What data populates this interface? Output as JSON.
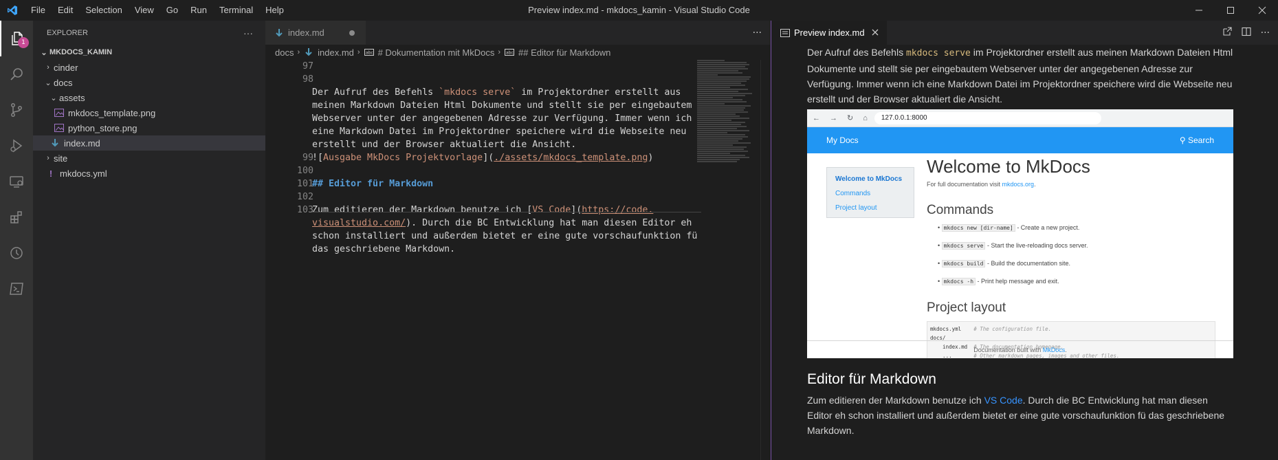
{
  "titlebar": {
    "title": "Preview index.md - mkdocs_kamin - Visual Studio Code",
    "menu": [
      "File",
      "Edit",
      "Selection",
      "View",
      "Go",
      "Run",
      "Terminal",
      "Help"
    ]
  },
  "activitybar": {
    "explorer_badge": "1",
    "items": [
      "explorer-icon",
      "search-icon",
      "source-control-icon",
      "run-debug-icon",
      "remote-explorer-icon",
      "extensions-icon",
      "timeline-icon",
      "terminal-icon"
    ]
  },
  "sidebar": {
    "header": "EXPLORER",
    "more": "···",
    "section": "MKDOCS_KAMIN",
    "tree": [
      {
        "label": "cinder",
        "type": "folder",
        "open": false,
        "depth": 0
      },
      {
        "label": "docs",
        "type": "folder",
        "open": true,
        "depth": 0
      },
      {
        "label": "assets",
        "type": "folder",
        "open": true,
        "depth": 1
      },
      {
        "label": "mkdocs_template.png",
        "type": "image",
        "depth": 2
      },
      {
        "label": "python_store.png",
        "type": "image",
        "depth": 2
      },
      {
        "label": "index.md",
        "type": "markdown",
        "depth": 1,
        "selected": true
      },
      {
        "label": "site",
        "type": "folder",
        "open": false,
        "depth": 0
      },
      {
        "label": "mkdocs.yml",
        "type": "yaml",
        "depth": 0
      }
    ]
  },
  "editor": {
    "tab_label": "index.md",
    "more": "···",
    "breadcrumbs": [
      "docs",
      "index.md",
      "# Dokumentation mit MkDocs",
      "## Editor für Markdown"
    ],
    "line_numbers": [
      "97",
      "98",
      "99",
      "100",
      "101",
      "102",
      "103"
    ],
    "lines": {
      "l98a": "Der Aufruf des Befehls ",
      "l98b": "`mkdocs serve`",
      "l98c": " im Projektordner erstellt aus",
      "l98d": "meinen Markdown Dateien Html Dokumente und stellt sie per eingebautem",
      "l98e": "Webserver unter der angegebenen Adresse zur Verfügung. Immer wenn ich",
      "l98f": "eine Markdown Datei im Projektordner speichere wird die Webseite neu",
      "l98g": "erstellt und der Browser aktualiert die Ansicht.",
      "l99a": "![",
      "l99b": "Ausgabe MkDocs Projektvorlage",
      "l99c": "](",
      "l99d": "./assets/mkdocs_template.png",
      "l99e": ")",
      "l101": "## Editor für Markdown",
      "l103a": "Zum editieren der Markdown benutze ich [",
      "l103b": "VS Code",
      "l103c": "](",
      "l103d": "https://code.",
      "l103e": "visualstudio.com/",
      "l103f": "). Durch die BC Entwicklung hat man diesen Editor eh",
      "l103g": "schon installiert und außerdem bietet er eine gute vorschaufunktion fü",
      "l103h": "das geschriebene Markdown."
    }
  },
  "preview": {
    "tab_label": "Preview index.md",
    "para1_a": "Der Aufruf des Befehls ",
    "para1_code": "mkdocs serve",
    "para1_b": " im Projektordner erstellt aus meinen Markdown Dateien Html Dokumente und stellt sie per eingebautem Webserver unter der angegebenen Adresse zur Verfügung. Immer wenn ich eine Markdown Datei im Projektordner speichere wird die Webseite neu erstellt und der Browser aktualiert die Ansicht.",
    "heading": "Editor für Markdown",
    "para2_a": "Zum editieren der Markdown benutze ich ",
    "para2_link": "VS Code",
    "para2_b": ". Durch die BC Entwicklung hat man diesen Editor eh schon installiert und außerdem bietet er eine gute vorschaufunktion fü das geschriebene Markdown.",
    "shot": {
      "url": "127.0.0.1:8000",
      "brand": "My Docs",
      "search": "Search",
      "toc": [
        "Welcome to MkDocs",
        "Commands",
        "Project layout"
      ],
      "h1": "Welcome to MkDocs",
      "intro_a": "For full documentation visit ",
      "intro_link": "mkdocs.org",
      "intro_b": ".",
      "h2_commands": "Commands",
      "commands": [
        {
          "code": "mkdocs new [dir-name]",
          "text": " - Create a new project."
        },
        {
          "code": "mkdocs serve",
          "text": " - Start the live-reloading docs server."
        },
        {
          "code": "mkdocs build",
          "text": " - Build the documentation site."
        },
        {
          "code": "mkdocs -h",
          "text": " - Print help message and exit."
        }
      ],
      "h2_layout": "Project layout",
      "layout_lines": [
        {
          "a": "mkdocs.yml    ",
          "c": "# The configuration file."
        },
        {
          "a": "docs/",
          "c": ""
        },
        {
          "a": "    index.md  ",
          "c": "# The documentation homepage."
        },
        {
          "a": "    ...       ",
          "c": "# Other markdown pages, images and other files."
        }
      ],
      "footer_a": "Documentation built with ",
      "footer_link": "MkDocs",
      "footer_b": "."
    }
  },
  "colors": {
    "accent": "#7a52a8",
    "badge": "#c84b95",
    "link": "#3794ff"
  }
}
